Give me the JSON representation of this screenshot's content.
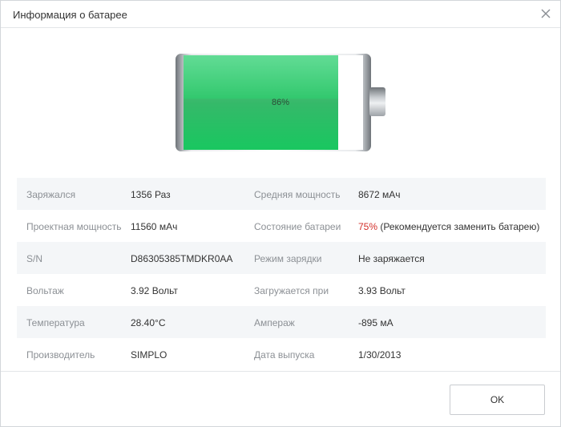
{
  "window": {
    "title": "Информация о батарее"
  },
  "battery": {
    "percent_label": "86%",
    "charge_fraction": 0.86,
    "fill_color": "#1fcb68"
  },
  "rows": [
    {
      "label1": "Заряжался",
      "value1": "1356 Раз",
      "label2": "Средняя мощность",
      "value2": "8672 мАч"
    },
    {
      "label1": "Проектная мощность",
      "value1": "11560 мАч",
      "label2": "Состояние батареи",
      "value2_highlight": "75%",
      "value2_rest": " (Рекомендуется заменить батарею)"
    },
    {
      "label1": "S/N",
      "value1": "D86305385TMDKR0AA",
      "label2": "Режим зарядки",
      "value2": "Не заряжается"
    },
    {
      "label1": "Вольтаж",
      "value1": "3.92 Вольт",
      "label2": "Загружается при",
      "value2": "3.93 Вольт"
    },
    {
      "label1": "Температура",
      "value1": "28.40°C",
      "label2": "Ампераж",
      "value2": "-895 мА"
    },
    {
      "label1": "Производитель",
      "value1": "SIMPLO",
      "label2": "Дата выпуска",
      "value2": "1/30/2013"
    }
  ],
  "footer": {
    "ok_label": "OK"
  },
  "colors": {
    "warning": "#d3302b",
    "label": "#8c9095",
    "row_shade": "#f4f6f8"
  }
}
